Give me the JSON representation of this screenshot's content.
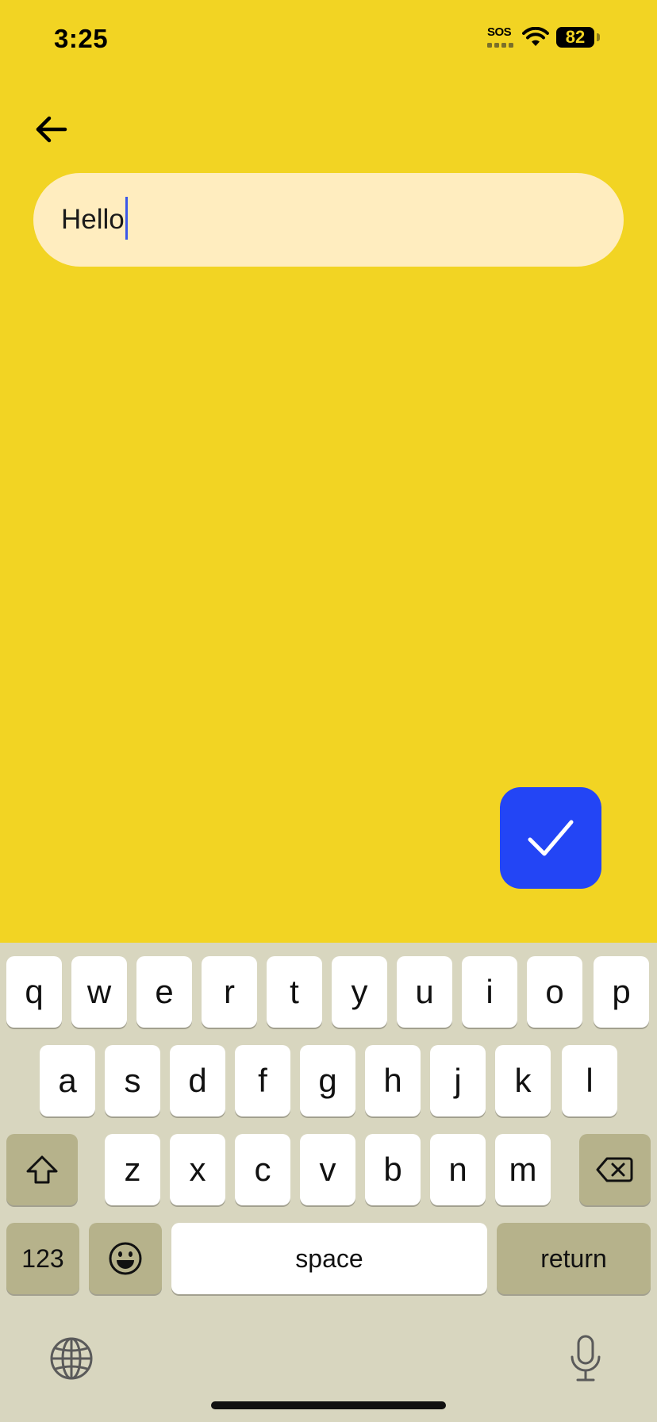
{
  "status_bar": {
    "time": "3:25",
    "sos": "SOS",
    "battery": "82"
  },
  "header": {
    "back_icon": "arrow-left-icon"
  },
  "input": {
    "value": "Hello"
  },
  "confirm": {
    "icon": "checkmark-icon"
  },
  "colors": {
    "background": "#F2D423",
    "input_bg": "#FFEDBF",
    "accent": "#2345F5",
    "keyboard_bg": "#D8D6BF",
    "key_fn": "#B6B28B"
  },
  "keyboard": {
    "row1": [
      "q",
      "w",
      "e",
      "r",
      "t",
      "y",
      "u",
      "i",
      "o",
      "p"
    ],
    "row2": [
      "a",
      "s",
      "d",
      "f",
      "g",
      "h",
      "j",
      "k",
      "l"
    ],
    "row3": [
      "z",
      "x",
      "c",
      "v",
      "b",
      "n",
      "m"
    ],
    "numbers_label": "123",
    "space_label": "space",
    "return_label": "return",
    "shift_icon": "shift-icon",
    "delete_icon": "backspace-icon",
    "emoji_icon": "emoji-icon",
    "globe_icon": "globe-icon",
    "mic_icon": "microphone-icon"
  }
}
